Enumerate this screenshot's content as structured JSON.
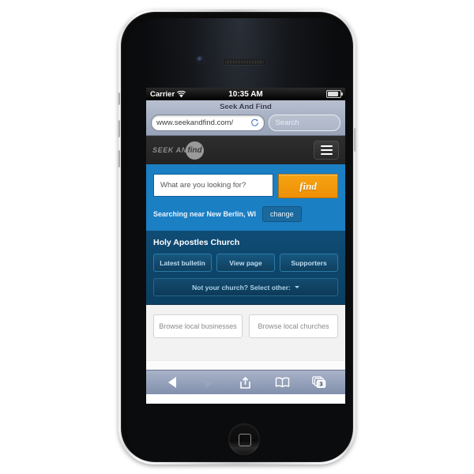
{
  "device": {
    "name": "iPhone",
    "home_button": "home-button"
  },
  "status_bar": {
    "carrier": "Carrier",
    "wifi_icon": "wifi-icon",
    "time": "10:35 AM",
    "battery_icon": "battery-icon"
  },
  "browser": {
    "page_title": "Seek And Find",
    "url": "www.seekandfind.com/",
    "reload_icon": "reload-icon",
    "search_placeholder": "Search",
    "toolbar": {
      "back_icon": "back-arrow-icon",
      "forward_icon": "forward-arrow-icon",
      "share_icon": "share-icon",
      "bookmarks_icon": "bookmarks-icon",
      "tabs_icon": "tabs-icon",
      "tab_count": "3"
    }
  },
  "site": {
    "logo_text": "SEEK AND",
    "logo_badge": "find",
    "menu_icon": "hamburger-menu-icon",
    "accent_blue": "#1b7fc4",
    "accent_orange": "#ef8f05",
    "search": {
      "placeholder": "What are you looking for?",
      "button_label": "find"
    },
    "location": {
      "text": "Searching near New Berlin, WI",
      "change_label": "change"
    },
    "church": {
      "name": "Holy Apostles Church",
      "buttons": [
        {
          "label": "Latest bulletin"
        },
        {
          "label": "View page"
        },
        {
          "label": "Supporters"
        }
      ],
      "select_other": "Not your church? Select other:"
    },
    "browse": [
      {
        "label": "Browse local businesses"
      },
      {
        "label": "Browse local churches"
      }
    ]
  }
}
